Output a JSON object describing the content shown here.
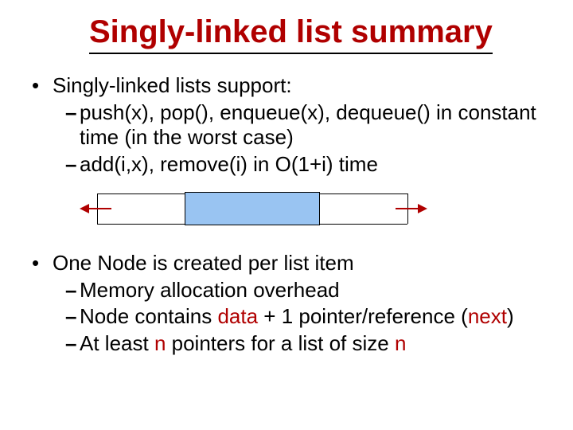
{
  "title": "Singly-linked list summary",
  "section1": {
    "heading": "Singly-linked lists support:",
    "items": [
      {
        "text": "push(x), pop(), enqueue(x), dequeue() in constant time (in the worst case)"
      },
      {
        "text": "add(i,x), remove(i) in O(1+i) time"
      }
    ]
  },
  "section2": {
    "heading": "One Node is created per list item",
    "items": [
      {
        "text": "Memory allocation overhead"
      },
      {
        "pre": "Node contains ",
        "em1": "data",
        "mid": " + 1 pointer/reference (",
        "em2": "next",
        "post": ")"
      },
      {
        "pre": "At least ",
        "em1": "n",
        "mid": " pointers for a list of size ",
        "em2": "n",
        "post": ""
      }
    ]
  }
}
